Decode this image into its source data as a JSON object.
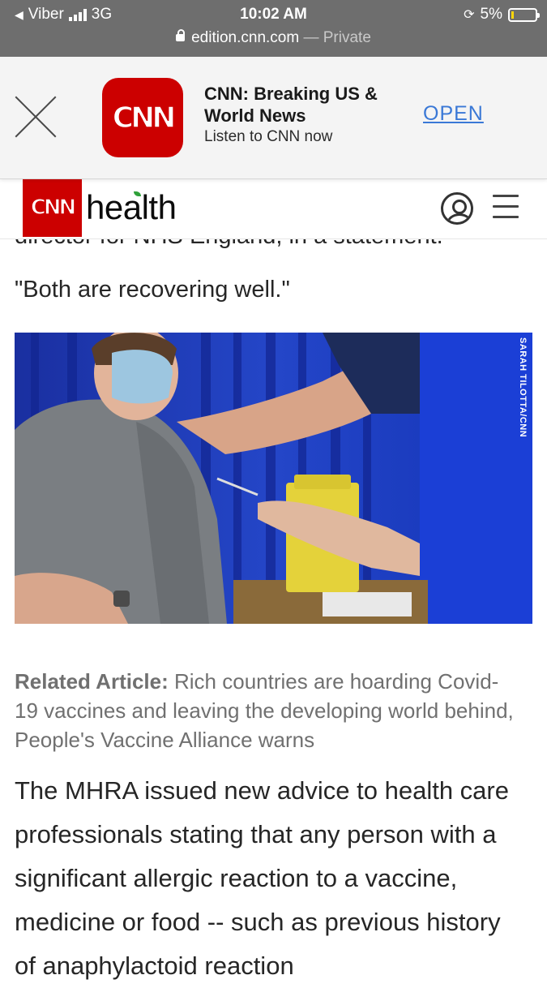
{
  "status_bar": {
    "carrier": "Viber",
    "network": "3G",
    "time": "10:02 AM",
    "battery": "5%",
    "battery_level": 0.05
  },
  "url_bar": {
    "domain": "edition.cnn.com",
    "mode": "— Private"
  },
  "app_banner": {
    "icon_text": "CNN",
    "title": "CNN: Breaking US & World News",
    "subtitle": "Listen to CNN now",
    "open_label": "OPEN"
  },
  "site_header": {
    "logo_text": "CNN",
    "section": "health"
  },
  "article": {
    "partial_line": "director for NHS England, in a statement.",
    "quote_end": "\"Both are recovering well.\"",
    "photo_credit": "SARAH TILOTTA/CNN",
    "related_label": "Related Article:",
    "related_text": "Rich countries are hoarding Covid-19 vaccines and leaving the developing world behind, People's Vaccine Alliance warns",
    "body": "The MHRA issued new advice to health care professionals stating that any person with a significant allergic reaction to a vaccine, medicine or food -- such as previous history of anaphylactoid reaction"
  },
  "colors": {
    "cnn_red": "#cc0000",
    "link_blue": "#3a78d6",
    "system_bar": "#6e6e6e",
    "battery_low": "#ffd60a"
  }
}
